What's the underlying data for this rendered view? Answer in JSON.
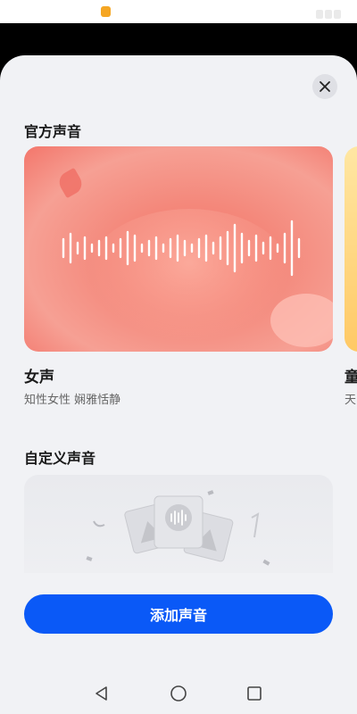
{
  "status_bar": {
    "notification_icon": "app-notification-icon"
  },
  "sheet": {
    "close_icon": "close-icon",
    "official_section": {
      "title": "官方声音",
      "cards": [
        {
          "name": "女声",
          "description": "知性女性 娴雅恬静",
          "waveform_icon": "waveform-icon"
        },
        {
          "name": "童",
          "description": "天"
        }
      ]
    },
    "custom_section": {
      "title": "自定义声音",
      "illustration": "voice-cards-illustration"
    },
    "add_button_label": "添加声音"
  },
  "nav_bar": {
    "back_icon": "back-triangle-icon",
    "home_icon": "home-circle-icon",
    "recent_icon": "recent-square-icon"
  },
  "colors": {
    "primary": "#0a59f7",
    "sheet_bg": "#f1f2f5",
    "card_coral": "#f3776a",
    "card_yellow": "#ffc965"
  }
}
